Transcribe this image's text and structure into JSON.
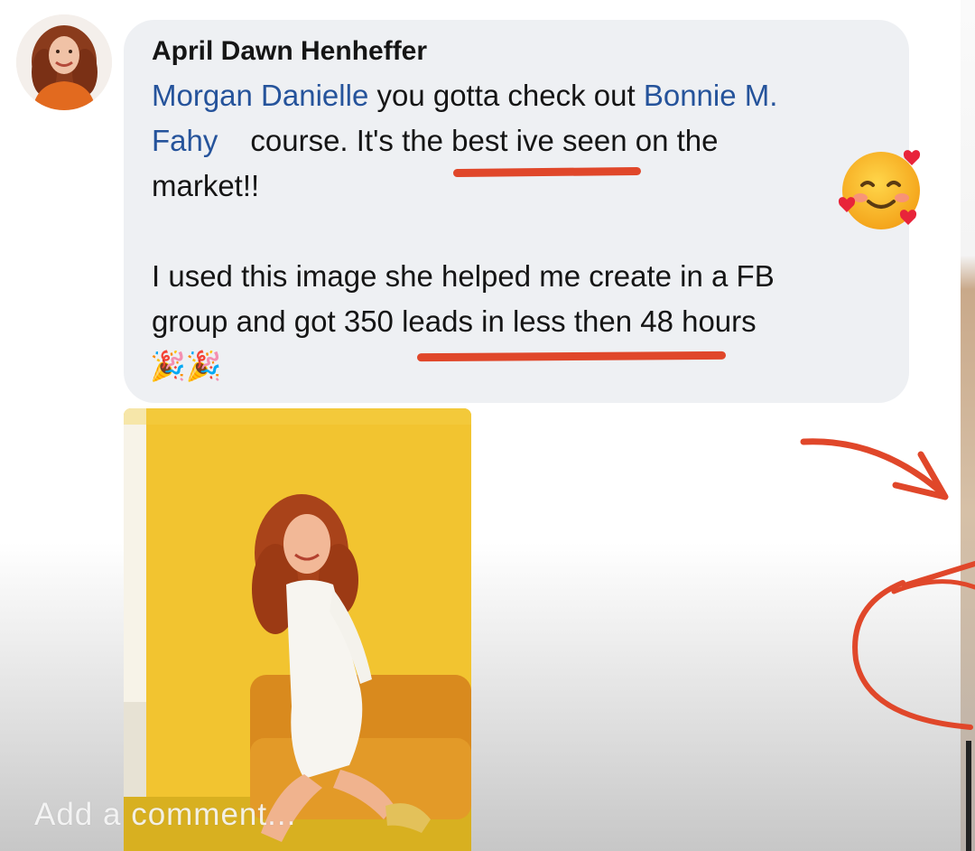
{
  "comment": {
    "author": "April Dawn Henheffer",
    "line1": {
      "mention": "Morgan Danielle",
      "text": " you gotta check out ",
      "mention2": "Bonnie M."
    },
    "line2": {
      "mention": "Fahy",
      "text": "course. It's the best ive seen on the"
    },
    "line3": "market!!",
    "line4": "I used this image she helped me create in a FB",
    "line5": "group and got 350 leads in less then 48 hours",
    "emoji_reaction": "🥰",
    "emoji_party": "🎉🎉"
  },
  "input": {
    "placeholder": "Add a comment..."
  },
  "colors": {
    "mention": "#25539b",
    "bubble": "#eef0f3",
    "annotation_red": "#e0472a",
    "photo_background": "#f0c332"
  },
  "icons": {
    "avatar": "avatar-photo",
    "attached_image": "woman-portrait-photo"
  }
}
